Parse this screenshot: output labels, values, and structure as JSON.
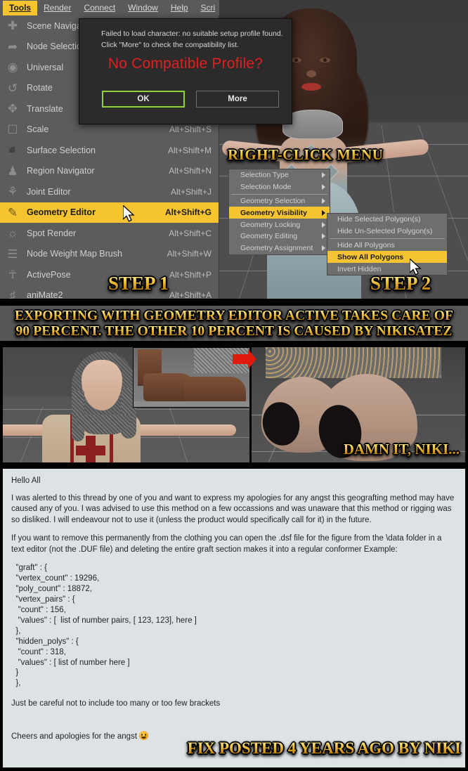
{
  "app": {
    "menubar": [
      {
        "label": "Tools",
        "accel": "T",
        "active": true
      },
      {
        "label": "Render",
        "accel": "R",
        "active": false
      },
      {
        "label": "Connect",
        "accel": "o",
        "active": false
      },
      {
        "label": "Window",
        "accel": "W",
        "active": false
      },
      {
        "label": "Help",
        "accel": "H",
        "active": false
      },
      {
        "label": "Scri",
        "accel": "S",
        "active": false
      }
    ],
    "tools_menu": [
      {
        "label": "Scene Navigator",
        "shortcut": "",
        "icon": "scene-navigator-icon",
        "selected": false
      },
      {
        "label": "Node Selection",
        "shortcut": "",
        "icon": "node-selection-icon",
        "selected": false
      },
      {
        "label": "Universal",
        "shortcut": "",
        "icon": "universal-icon",
        "selected": false
      },
      {
        "label": "Rotate",
        "shortcut": "",
        "icon": "rotate-icon",
        "selected": false
      },
      {
        "label": "Translate",
        "shortcut": "",
        "icon": "translate-icon",
        "selected": false
      },
      {
        "label": "Scale",
        "shortcut": "Alt+Shift+S",
        "icon": "scale-icon",
        "selected": false
      },
      {
        "label": "Surface Selection",
        "shortcut": "Alt+Shift+M",
        "icon": "surface-selection-icon",
        "selected": false
      },
      {
        "label": "Region Navigator",
        "shortcut": "Alt+Shift+N",
        "icon": "region-navigator-icon",
        "selected": false
      },
      {
        "label": "Joint Editor",
        "shortcut": "Alt+Shift+J",
        "icon": "joint-editor-icon",
        "selected": false
      },
      {
        "label": "Geometry Editor",
        "shortcut": "Alt+Shift+G",
        "icon": "geometry-editor-icon",
        "selected": true
      },
      {
        "label": "Spot Render",
        "shortcut": "Alt+Shift+C",
        "icon": "spot-render-icon",
        "selected": false
      },
      {
        "label": "Node Weight Map Brush",
        "shortcut": "Alt+Shift+W",
        "icon": "weight-map-brush-icon",
        "selected": false
      },
      {
        "label": "ActivePose",
        "shortcut": "Alt+Shift+P",
        "icon": "activepose-icon",
        "selected": false
      },
      {
        "label": "aniMate2",
        "shortcut": "Alt+Shift+A",
        "icon": "animate2-icon",
        "selected": false
      }
    ],
    "dialog": {
      "message_line1": "Failed to load character: no suitable setup profile found.",
      "message_line2": "Click \"More\" to check the compatibility list.",
      "headline": "No Compatible Profile?",
      "headline_color": "#e02020",
      "ok_label": "OK",
      "more_label": "More",
      "ok_border_color": "#8fd13a"
    },
    "context_menu": {
      "title": "RIGHT-CLICK MENU",
      "level1": [
        {
          "label": "Selection Type",
          "submenu": true,
          "selected": false
        },
        {
          "label": "Selection Mode",
          "submenu": true,
          "selected": false
        },
        {
          "label": "Geometry Selection",
          "submenu": true,
          "selected": false
        },
        {
          "label": "Geometry Visibility",
          "submenu": true,
          "selected": true
        },
        {
          "label": "Geometry Locking",
          "submenu": true,
          "selected": false
        },
        {
          "label": "Geometry Editing",
          "submenu": true,
          "selected": false
        },
        {
          "label": "Geometry Assignment",
          "submenu": true,
          "selected": false
        }
      ],
      "level2": [
        {
          "label": "Hide Selected Polygon(s)",
          "selected": false
        },
        {
          "label": "Hide Un-Selected Polygon(s)",
          "selected": false
        },
        {
          "label": "Hide All Polygons",
          "selected": false
        },
        {
          "label": "Show All Polygons",
          "selected": true
        },
        {
          "label": "Invert Hidden",
          "selected": false
        }
      ]
    },
    "step1_label": "STEP 1",
    "step2_label": "STEP 2",
    "highlight_color": "#f5c430"
  },
  "banner1": {
    "line1": "EXPORTING WITH GEOMETRY EDITOR ACTIVE TAKES CARE OF",
    "line2": "90 PERCENT. THE OTHER 10 PERCENT IS CAUSED BY NIKISATEZ"
  },
  "panel2": {
    "damn_it_label": "DAMN IT, NIKI..."
  },
  "post": {
    "greeting": "Hello All",
    "paragraph1": "I was alerted to this thread by one of you and want to express my apologies for any angst this geografting method may have caused any of you. I was advised to use this method on a few occassions and was unaware that this method or rigging was so disliked. I will endeavour not to use it (unless the product would specifically call for it) in the future.",
    "paragraph2": "If you want to remove this permanently from the clothing you can open the .dsf file for the figure from the \\data folder in a text editor (not the .DUF file) and deleting the entire graft section makes it into a regular conformer Example:",
    "code": "  \"graft\" : {\n  \"vertex_count\" : 19296,\n  \"poly_count\" : 18872,\n  \"vertex_pairs\" : {\n   \"count\" : 156,\n   \"values\" : [  list of number pairs, [ 123, 123], here ]\n  },\n  \"hidden_polys\" : {\n   \"count\" : 318,\n   \"values\" : [ list of number here ]\n  }\n  },",
    "paragraph3": "Just be careful not to include too many or too few brackets",
    "signoff": "Cheers and apologies for the angst",
    "fix_posted_label": "FIX POSTED 4 YEARS AGO BY NIKI"
  }
}
